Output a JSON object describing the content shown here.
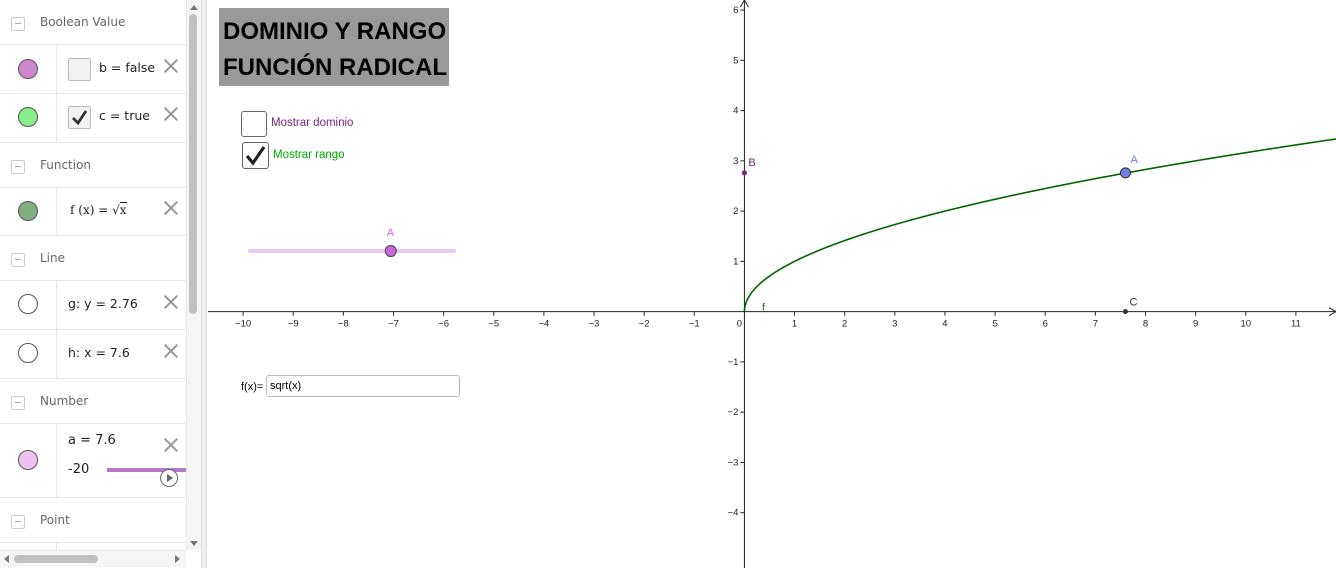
{
  "algebra": {
    "categories": {
      "boolean": "Boolean Value",
      "function": "Function",
      "line": "Line",
      "number": "Number",
      "point": "Point"
    },
    "items": {
      "b": {
        "text": "b = false",
        "checked": false,
        "color": "#cc77cc"
      },
      "c": {
        "text": "c = true",
        "checked": true,
        "color": "#80ee80"
      },
      "f": {
        "lhs": "f (x) = ",
        "rad": "√",
        "arg": "x",
        "color": "#80b080"
      },
      "g": {
        "text": "g: y = 2.76"
      },
      "h": {
        "text": "h: x = 7.6"
      },
      "a": {
        "text": "a = 7.6",
        "min": "-20",
        "value": 7.6,
        "color": "#eebbee"
      }
    }
  },
  "graphics": {
    "title": {
      "line1": "DOMINIO Y RANGO",
      "line2": "FUNCIÓN RADICAL"
    },
    "checkboxes": {
      "dominio": {
        "label": "Mostrar dominio",
        "checked": false,
        "color": "#7a1f7a"
      },
      "rango": {
        "label": "Mostrar rango",
        "checked": true,
        "color": "#00aa00"
      }
    },
    "slider_label": "A",
    "input": {
      "label": "f(x)=",
      "value": "sqrt(x)"
    },
    "point_labels": {
      "A": "A",
      "B": "B",
      "C": "C",
      "f": "f"
    }
  },
  "chart_data": {
    "type": "line",
    "function": "sqrt(x)",
    "xlim": [
      -10.7,
      11.8
    ],
    "ylim": [
      -5.1,
      6.2
    ],
    "x_ticks": [
      -10,
      -9,
      -8,
      -7,
      -6,
      -5,
      -4,
      -3,
      -2,
      -1,
      0,
      1,
      2,
      3,
      4,
      5,
      6,
      7,
      8,
      9,
      10,
      11
    ],
    "y_ticks": [
      -4,
      -3,
      -2,
      -1,
      1,
      2,
      3,
      4,
      5,
      6
    ],
    "tick_labels_x": [
      "−10",
      "−9",
      "−8",
      "−7",
      "−6",
      "−5",
      "−4",
      "−3",
      "−2",
      "−1",
      "0",
      "1",
      "2",
      "3",
      "4",
      "5",
      "6",
      "7",
      "8",
      "9",
      "10",
      "11"
    ],
    "tick_labels_y": [
      "−4",
      "−3",
      "−2",
      "−1",
      "1",
      "2",
      "3",
      "4",
      "5",
      "6"
    ],
    "points": [
      {
        "name": "A",
        "x": 7.6,
        "y": 2.76,
        "color": "#6f7fe8"
      },
      {
        "name": "B",
        "x": 0,
        "y": 2.76,
        "color": "#7a1f7a"
      },
      {
        "name": "C",
        "x": 7.6,
        "y": 0,
        "color": "#333333"
      }
    ],
    "curve_color": "#006400",
    "slider_accent": "#cc66dd"
  }
}
